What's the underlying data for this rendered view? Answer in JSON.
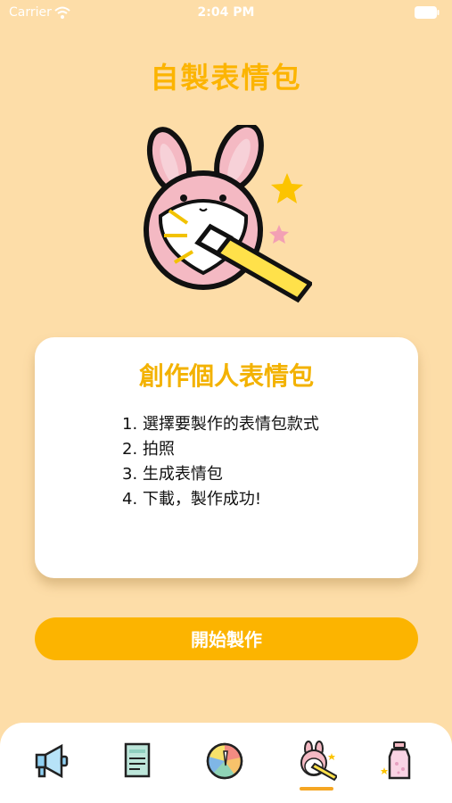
{
  "status_bar": {
    "carrier": "Carrier",
    "time": "2:04 PM"
  },
  "page": {
    "title": "自製表情包"
  },
  "card": {
    "title": "創作個人表情包",
    "steps": [
      "1. 選擇要製作的表情包款式",
      "2. 拍照",
      "3. 生成表情包",
      "4. 下載，製作成功!"
    ]
  },
  "actions": {
    "start_label": "開始製作"
  },
  "tab_bar": {
    "tabs": [
      {
        "icon": "megaphone-icon"
      },
      {
        "icon": "document-icon"
      },
      {
        "icon": "color-wheel-icon"
      },
      {
        "icon": "bunny-wand-icon",
        "selected": true
      },
      {
        "icon": "bottle-icon"
      }
    ]
  },
  "colors": {
    "background": "#FDDDA8",
    "accent": "#FCB400",
    "card": "#FFFFFF"
  }
}
